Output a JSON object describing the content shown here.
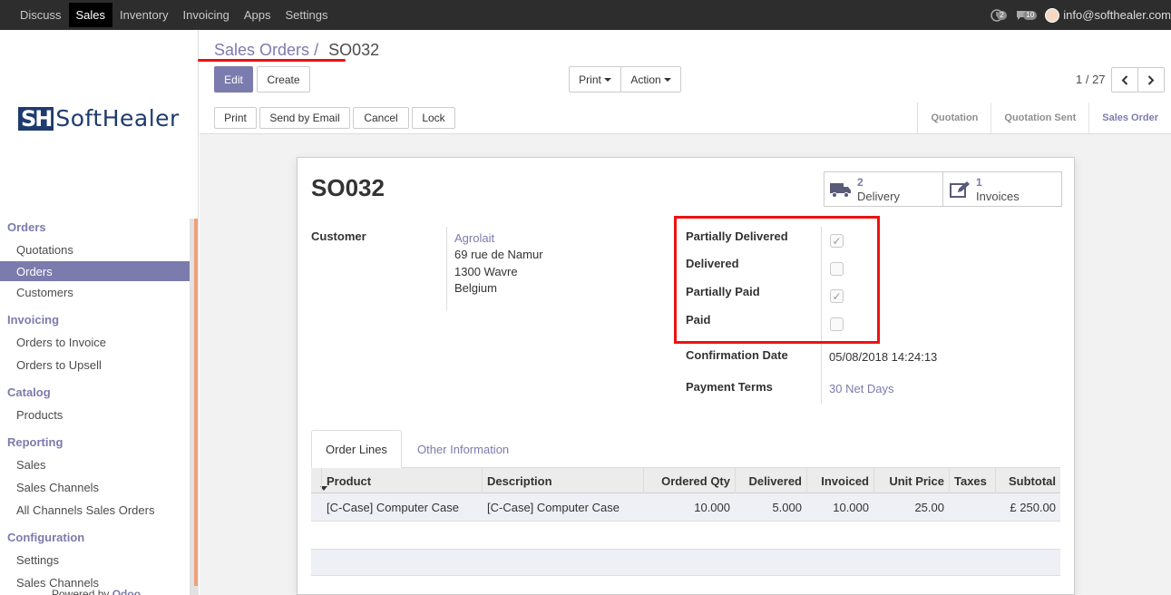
{
  "topbar": {
    "menu": [
      "Discuss",
      "Sales",
      "Inventory",
      "Invoicing",
      "Apps",
      "Settings"
    ],
    "active_menu": "Sales",
    "activity_count": "2",
    "message_count": "10",
    "user_email": "info@softhealer.com"
  },
  "sidebar": {
    "logo_mark": "SH",
    "logo_text": "SoftHealer",
    "sections": [
      {
        "title": "Orders",
        "items": [
          "Quotations",
          "Orders",
          "Customers"
        ]
      },
      {
        "title": "Invoicing",
        "items": [
          "Orders to Invoice",
          "Orders to Upsell"
        ]
      },
      {
        "title": "Catalog",
        "items": [
          "Products"
        ]
      },
      {
        "title": "Reporting",
        "items": [
          "Sales",
          "Sales Channels",
          "All Channels Sales Orders"
        ]
      },
      {
        "title": "Configuration",
        "items": [
          "Settings",
          "Sales Channels"
        ]
      }
    ],
    "active_item": "Orders",
    "powered_prefix": "Powered by",
    "powered_brand": "Odoo"
  },
  "control_panel": {
    "breadcrumb_parent": "Sales Orders",
    "breadcrumb_sep": "/",
    "breadcrumb_current": "SO032",
    "edit_label": "Edit",
    "create_label": "Create",
    "print_label": "Print",
    "action_label": "Action",
    "pager": "1 / 27"
  },
  "header_buttons": {
    "print": "Print",
    "send_email": "Send by Email",
    "cancel": "Cancel",
    "lock": "Lock"
  },
  "statusbar": [
    "Quotation",
    "Quotation Sent",
    "Sales Order"
  ],
  "status_current": "Sales Order",
  "form": {
    "title": "SO032",
    "smart_buttons": {
      "delivery_count": "2",
      "delivery_label": "Delivery",
      "invoice_count": "1",
      "invoice_label": "Invoices"
    },
    "customer_label": "Customer",
    "customer_name": "Agrolait",
    "customer_address": [
      "69 rue de Namur",
      "1300 Wavre",
      "Belgium"
    ],
    "flags": [
      {
        "label": "Partially Delivered",
        "checked": true
      },
      {
        "label": "Delivered",
        "checked": false
      },
      {
        "label": "Partially Paid",
        "checked": true
      },
      {
        "label": "Paid",
        "checked": false
      }
    ],
    "confirmation_date_label": "Confirmation Date",
    "confirmation_date": "05/08/2018 14:24:13",
    "payment_terms_label": "Payment Terms",
    "payment_terms": "30 Net Days",
    "tabs": [
      "Order Lines",
      "Other Information"
    ],
    "active_tab": "Order Lines"
  },
  "order_lines": {
    "columns": [
      "Product",
      "Description",
      "Ordered Qty",
      "Delivered",
      "Invoiced",
      "Unit Price",
      "Taxes",
      "Subtotal"
    ],
    "rows": [
      [
        "[C-Case] Computer Case",
        "[C-Case] Computer Case",
        "10.000",
        "5.000",
        "10.000",
        "25.00",
        "",
        "£ 250.00"
      ]
    ]
  },
  "colors": {
    "accent": "#7c7bad",
    "highlight": "#ee1111",
    "topbar": "#2d2d2d"
  }
}
